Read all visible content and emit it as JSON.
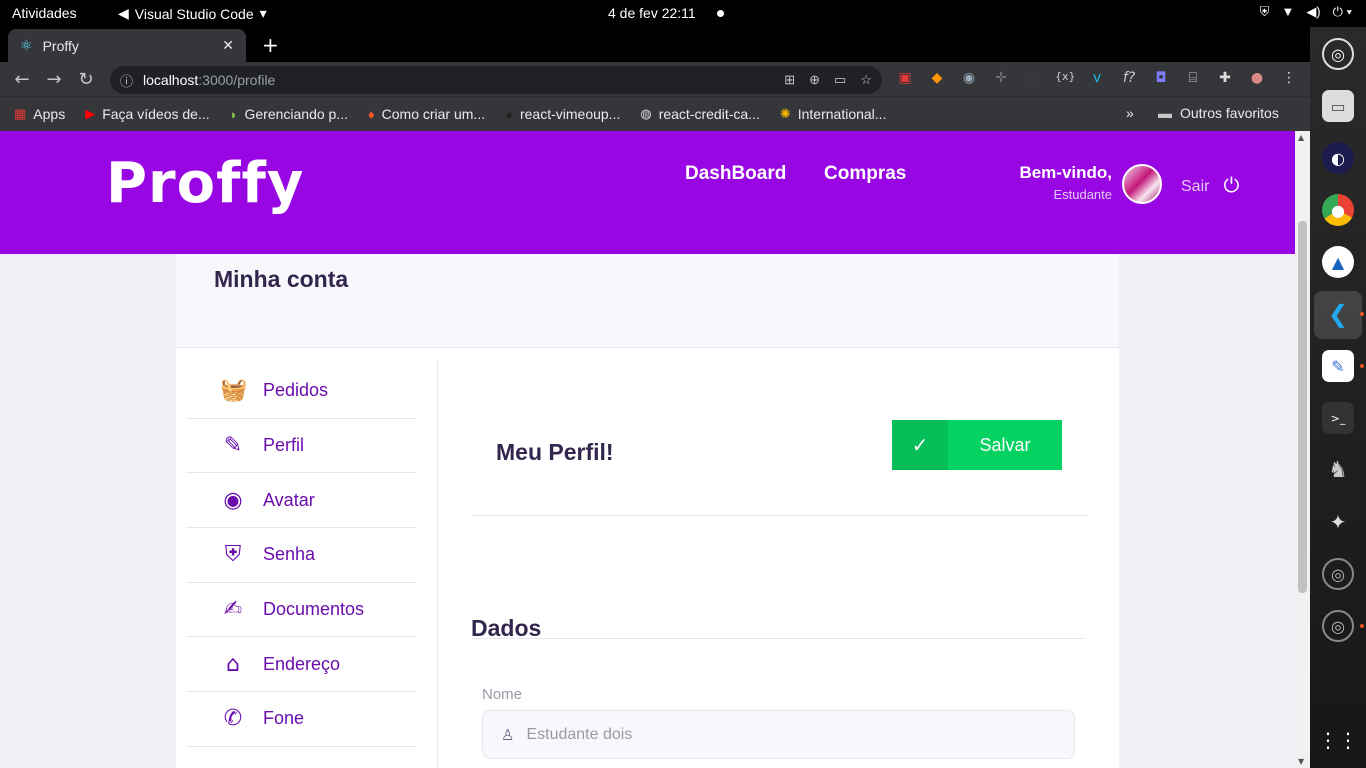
{
  "system": {
    "activities": "Atividades",
    "app_name": "Visual Studio Code",
    "datetime": "4 de fev  22:11"
  },
  "browser": {
    "tab_title": "Proffy",
    "url_host": "localhost",
    "url_path": ":3000/profile",
    "bookmarks": [
      {
        "label": "Apps"
      },
      {
        "label": "Faça vídeos de..."
      },
      {
        "label": "Gerenciando p..."
      },
      {
        "label": "Como criar um..."
      },
      {
        "label": "react-vimeoup..."
      },
      {
        "label": "react-credit-ca..."
      },
      {
        "label": "International..."
      }
    ],
    "bookmarks_more": "»",
    "other_bookmarks": "Outros favoritos"
  },
  "header": {
    "logo": "Proffy",
    "nav": [
      {
        "label": "DashBoard"
      },
      {
        "label": "Compras"
      }
    ],
    "welcome": "Bem-vindo,",
    "role": "Estudante",
    "logout": "Sair"
  },
  "page": {
    "title": "Minha conta",
    "sidebar": [
      {
        "label": "Pedidos",
        "icon": "basket-icon"
      },
      {
        "label": "Perfil",
        "icon": "user-edit-icon"
      },
      {
        "label": "Avatar",
        "icon": "user-circle-icon"
      },
      {
        "label": "Senha",
        "icon": "user-shield-icon"
      },
      {
        "label": "Documentos",
        "icon": "edit-document-icon"
      },
      {
        "label": "Endereço",
        "icon": "warehouse-icon"
      },
      {
        "label": "Fone",
        "icon": "phone-icon"
      }
    ],
    "profile_title": "Meu Perfil!",
    "save_label": "Salvar",
    "section_title": "Dados",
    "name_label": "Nome",
    "name_value": "Estudante dois"
  },
  "colors": {
    "header_bg": "#9906e4",
    "accent": "#6a0dad",
    "save_green": "#04d361",
    "title_text": "#32264d"
  }
}
